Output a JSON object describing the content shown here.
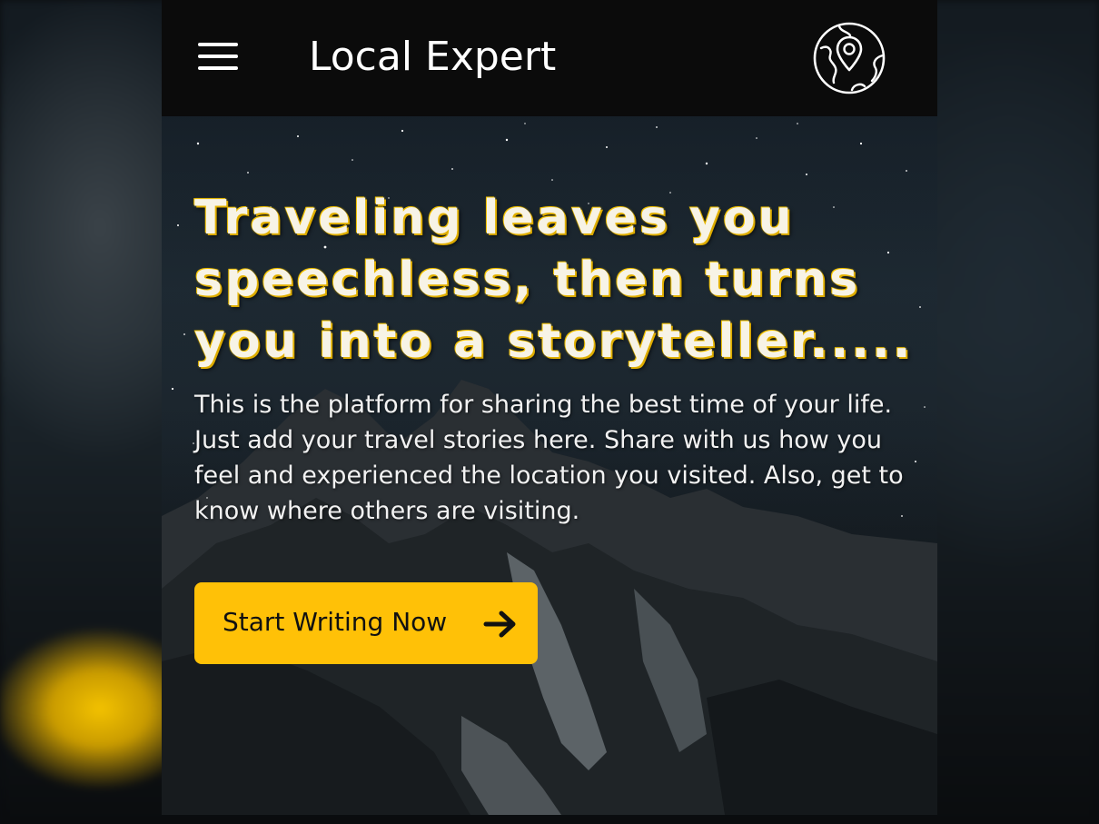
{
  "app": {
    "title": "Local Expert"
  },
  "header": {
    "menu_icon": "hamburger-menu-icon",
    "globe_icon": "globe-location-pin-icon"
  },
  "hero": {
    "headline": "Traveling leaves you speechless, then turns you into a storyteller.....",
    "description": "This is the platform for sharing the best time of your life. Just add your travel stories here. Share with us how you feel and experienced the location you visited. Also, get to know where others are visiting.",
    "cta_label": "Start Writing Now",
    "cta_icon": "arrow-right-icon"
  },
  "colors": {
    "accent": "#ffc107",
    "appbar": "#0b0b0b",
    "headline_glow": "#f5c400"
  }
}
